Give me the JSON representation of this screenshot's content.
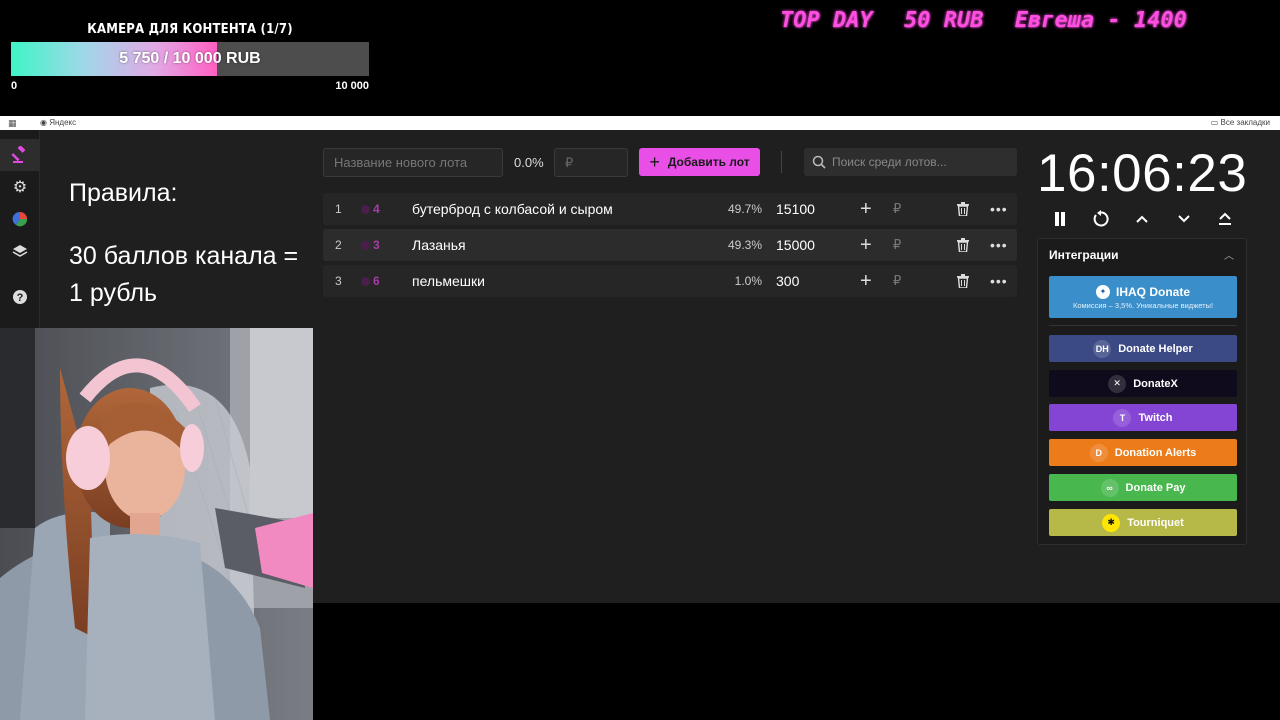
{
  "overlay": {
    "goal": {
      "title": "КАМЕРА ДЛЯ КОНТЕНТА (1/7)",
      "progress_text": "5 750 / 10 000 RUB",
      "progress_fraction": 0.575,
      "min_label": "0",
      "max_label": "10 000"
    },
    "ticker": {
      "items": [
        "TOP DAY",
        "50 RUB",
        "Евгеша - 1400"
      ]
    }
  },
  "browser": {
    "bookmark": "Яндекс",
    "all_bookmarks": "Все закладки"
  },
  "sidebar": {
    "items": [
      {
        "icon": "auction-gavel-icon",
        "active": true
      },
      {
        "icon": "gear-icon",
        "active": false
      },
      {
        "icon": "pie-chart-icon",
        "active": false
      },
      {
        "icon": "layers-icon",
        "active": false
      },
      {
        "icon": "help-icon",
        "active": false
      }
    ]
  },
  "rules": {
    "heading": "Правила:",
    "text": "30 баллов канала = 1 рубль"
  },
  "toolbar": {
    "new_lot_placeholder": "Название нового лота",
    "percent": "0.0%",
    "amount_placeholder": "₽",
    "add_button": "Добавить лот",
    "search_placeholder": "Поиск среди лотов..."
  },
  "lots": [
    {
      "num": "1",
      "votes": "4",
      "name": "бутерброд с колбасой и сыром",
      "percent": "49.7%",
      "amount": "15100"
    },
    {
      "num": "2",
      "votes": "3",
      "name": "Лазанья",
      "percent": "49.3%",
      "amount": "15000"
    },
    {
      "num": "3",
      "votes": "6",
      "name": "пельмешки",
      "percent": "1.0%",
      "amount": "300"
    }
  ],
  "timer": {
    "time": "16:06:23"
  },
  "integrations": {
    "title": "Интеграции",
    "ihaq": {
      "name": "IHAQ Donate",
      "subtitle": "Комиссия – 3,5%. Уникальные виджеты!"
    },
    "buttons": [
      {
        "key": "donate-helper",
        "label": "Donate Helper",
        "color": "#3b4a85",
        "logo": "DH"
      },
      {
        "key": "donatex",
        "label": "DonateX",
        "color": "#0f0a1c",
        "logo": "✕"
      },
      {
        "key": "twitch",
        "label": "Twitch",
        "color": "#8445d4",
        "logo": "T"
      },
      {
        "key": "donation-alerts",
        "label": "Donation Alerts",
        "color": "#ec7b1a",
        "logo": "D"
      },
      {
        "key": "donate-pay",
        "label": "Donate Pay",
        "color": "#48b84e",
        "logo": "∞"
      },
      {
        "key": "tourniquet",
        "label": "Tourniquet",
        "color": "#b6b847",
        "logo": "✱"
      }
    ]
  }
}
